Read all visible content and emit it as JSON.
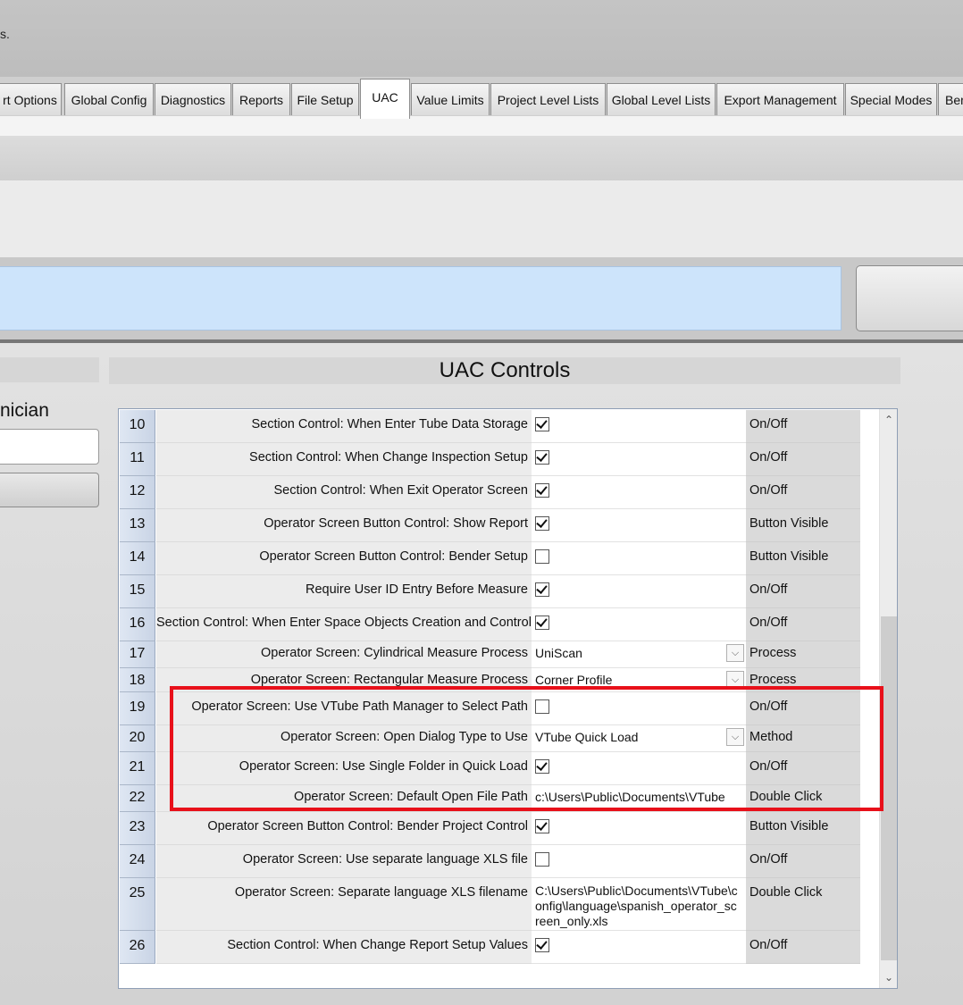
{
  "window": {
    "message": "s."
  },
  "tabs": [
    {
      "label": "rt Options"
    },
    {
      "label": "Global Config"
    },
    {
      "label": "Diagnostics"
    },
    {
      "label": "Reports"
    },
    {
      "label": "File Setup"
    },
    {
      "label": "UAC",
      "active": true
    },
    {
      "label": "Value Limits"
    },
    {
      "label": "Project Level Lists"
    },
    {
      "label": "Global Level Lists"
    },
    {
      "label": "Export Management"
    },
    {
      "label": "Special Modes"
    },
    {
      "label": "Ben"
    }
  ],
  "left_panel": {
    "label": "nician"
  },
  "uac": {
    "title": "UAC Controls",
    "rows": [
      {
        "num": "10",
        "name": "Section Control: When Enter Tube Data Storage",
        "checked": true,
        "type": "On/Off"
      },
      {
        "num": "11",
        "name": "Section Control: When Change Inspection Setup",
        "checked": true,
        "type": "On/Off"
      },
      {
        "num": "12",
        "name": "Section Control: When Exit Operator Screen",
        "checked": true,
        "type": "On/Off"
      },
      {
        "num": "13",
        "name": "Operator Screen Button Control: Show Report",
        "checked": true,
        "type": "Button Visible"
      },
      {
        "num": "14",
        "name": "Operator Screen Button Control: Bender Setup",
        "checked": false,
        "type": "Button Visible"
      },
      {
        "num": "15",
        "name": "Require User ID Entry Before Measure",
        "checked": true,
        "type": "On/Off"
      },
      {
        "num": "16",
        "name": "Section Control: When Enter Space Objects Creation and Control",
        "checked": true,
        "type": "On/Off"
      },
      {
        "num": "17",
        "name": "Operator Screen: Cylindrical Measure Process",
        "value": "UniScan",
        "dropdown": true,
        "type": "Process"
      },
      {
        "num": "18",
        "name": "Operator Screen: Rectangular Measure Process",
        "value": "Corner Profile",
        "dropdown": true,
        "type": "Process"
      },
      {
        "num": "19",
        "name": "Operator Screen: Use VTube Path Manager to Select Path",
        "checked": false,
        "type": "On/Off"
      },
      {
        "num": "20",
        "name": "Operator Screen: Open Dialog Type to Use",
        "value": "VTube Quick Load",
        "dropdown": true,
        "type": "Method"
      },
      {
        "num": "21",
        "name": "Operator Screen: Use Single Folder in Quick Load",
        "checked": true,
        "type": "On/Off"
      },
      {
        "num": "22",
        "name": "Operator Screen: Default Open File Path",
        "value": "c:\\Users\\Public\\Documents\\VTube",
        "type": "Double Click"
      },
      {
        "num": "23",
        "name": "Operator Screen Button Control: Bender Project Control",
        "checked": true,
        "type": "Button Visible"
      },
      {
        "num": "24",
        "name": "Operator Screen: Use separate language XLS file",
        "checked": false,
        "type": "On/Off"
      },
      {
        "num": "25",
        "name": "Operator Screen: Separate language XLS filename",
        "value": "C:\\Users\\Public\\Documents\\VTube\\config\\language\\spanish_operator_screen_only.xls",
        "multiline": true,
        "type": "Double Click"
      },
      {
        "num": "26",
        "name": "Section Control: When Change Report Setup Values",
        "checked": true,
        "type": "On/Off"
      }
    ]
  },
  "colors": {
    "highlight": "#e8101a",
    "blue_bar": "#cde4fb"
  }
}
